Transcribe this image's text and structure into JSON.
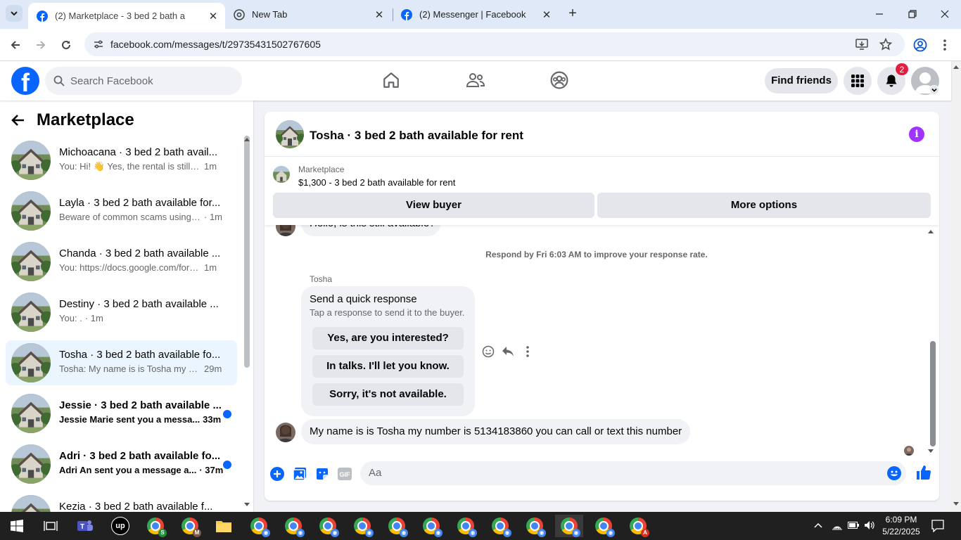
{
  "browser": {
    "tabs": [
      {
        "title": "(2) Marketplace - 3 bed 2 bath a",
        "icon": "facebook-icon",
        "active": true
      },
      {
        "title": "New Tab",
        "icon": "chrome-icon",
        "active": false
      },
      {
        "title": "(2) Messenger | Facebook",
        "icon": "facebook-icon",
        "active": false
      }
    ],
    "url": "facebook.com/messages/t/29735431502767605"
  },
  "fb_header": {
    "logo": "f",
    "search_placeholder": "Search Facebook",
    "find_friends": "Find friends",
    "notification_count": "2",
    "colors": {
      "brand": "#0866ff",
      "badge": "#e41e3f"
    }
  },
  "sidebar": {
    "title": "Marketplace",
    "conversations": [
      {
        "name": "Michoacana · 3 bed 2 bath avail...",
        "preview": "You: Hi! 👋 Yes, the rental is still av...",
        "time": "1m",
        "unread": false,
        "selected": false
      },
      {
        "name": "Layla · 3 bed 2 bath available for...",
        "preview": "Beware of common scams using p...",
        "time": "· 1m",
        "unread": false,
        "selected": false
      },
      {
        "name": "Chanda · 3 bed 2 bath available ...",
        "preview": "You: https://docs.google.com/form...",
        "time": "1m",
        "unread": false,
        "selected": false
      },
      {
        "name": "Destiny · 3 bed 2 bath available ...",
        "preview": "You: .",
        "time": "· 1m",
        "unread": false,
        "selected": false
      },
      {
        "name": "Tosha · 3 bed 2 bath available fo...",
        "preview": "Tosha: My name is is Tosha my nu...",
        "time": "29m",
        "unread": false,
        "selected": true
      },
      {
        "name": "Jessie · 3 bed 2 bath available ...",
        "preview": "Jessie Marie sent you a messa...",
        "time": "33m",
        "unread": true,
        "selected": false
      },
      {
        "name": "Adri · 3 bed 2 bath available fo...",
        "preview": "Adri An sent you a message a...",
        "time": "· 37m",
        "unread": true,
        "selected": false
      },
      {
        "name": "Kezia · 3 bed 2 bath available f...",
        "preview": "",
        "time": "",
        "unread": false,
        "selected": false
      }
    ]
  },
  "chat": {
    "title": "Tosha · 3 bed 2 bath available for rent",
    "listing_label": "Marketplace",
    "listing_price": "$1,300 - 3 bed 2 bath available for rent",
    "view_buyer": "View buyer",
    "more_options": "More options",
    "cut_message": "Hello, is this still available?",
    "respond_notice": "Respond by Fri 6:03 AM to improve your response rate.",
    "sender": "Tosha",
    "quick_response_title": "Send a quick response",
    "quick_response_sub": "Tap a response to send it to the buyer.",
    "quick_responses": [
      "Yes, are you interested?",
      "In talks. I'll let you know.",
      "Sorry, it's not available."
    ],
    "last_message": "My name is is Tosha my number is 5134183860 you can call or text this number",
    "composer_placeholder": "Aa"
  },
  "taskbar": {
    "time": "6:09 PM",
    "date": "5/22/2025"
  }
}
